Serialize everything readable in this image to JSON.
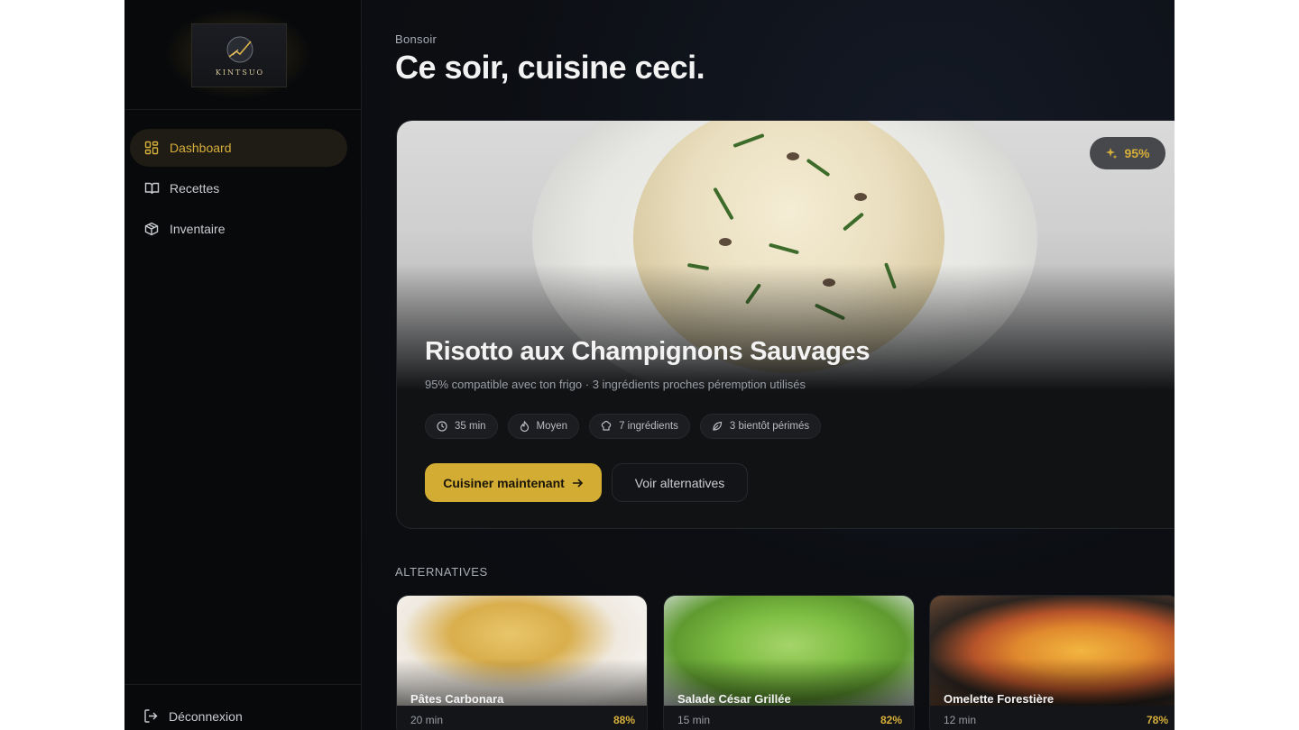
{
  "brand": {
    "logo_text": "KINTSUO"
  },
  "sidebar": {
    "items": [
      {
        "label": "Dashboard",
        "icon": "grid-icon",
        "active": true
      },
      {
        "label": "Recettes",
        "icon": "book-icon",
        "active": false
      },
      {
        "label": "Inventaire",
        "icon": "box-icon",
        "active": false
      }
    ],
    "logout_label": "Déconnexion"
  },
  "header": {
    "greeting": "Bonsoir",
    "title": "Ce soir, cuisine ceci."
  },
  "hero": {
    "match_badge": "95%",
    "title": "Risotto aux Champignons Sauvages",
    "subtitle": "95% compatible avec ton frigo · 3 ingrédients proches péremption utilisés",
    "chips": [
      {
        "label": "35 min",
        "icon": "clock-icon"
      },
      {
        "label": "Moyen",
        "icon": "flame-icon"
      },
      {
        "label": "7 ingrédients",
        "icon": "chef-hat-icon"
      },
      {
        "label": "3 bientôt périmés",
        "icon": "leaf-icon"
      }
    ],
    "primary_button": "Cuisiner maintenant",
    "secondary_button": "Voir alternatives"
  },
  "alternatives": {
    "label": "ALTERNATIVES",
    "items": [
      {
        "name": "Pâtes Carbonara",
        "time": "20 min",
        "score": "88%"
      },
      {
        "name": "Salade César Grillée",
        "time": "15 min",
        "score": "82%"
      },
      {
        "name": "Omelette Forestière",
        "time": "12 min",
        "score": "78%"
      }
    ]
  },
  "colors": {
    "accent": "#d2ac33",
    "background": "#0b0d10",
    "sidebar": "#08090b"
  }
}
